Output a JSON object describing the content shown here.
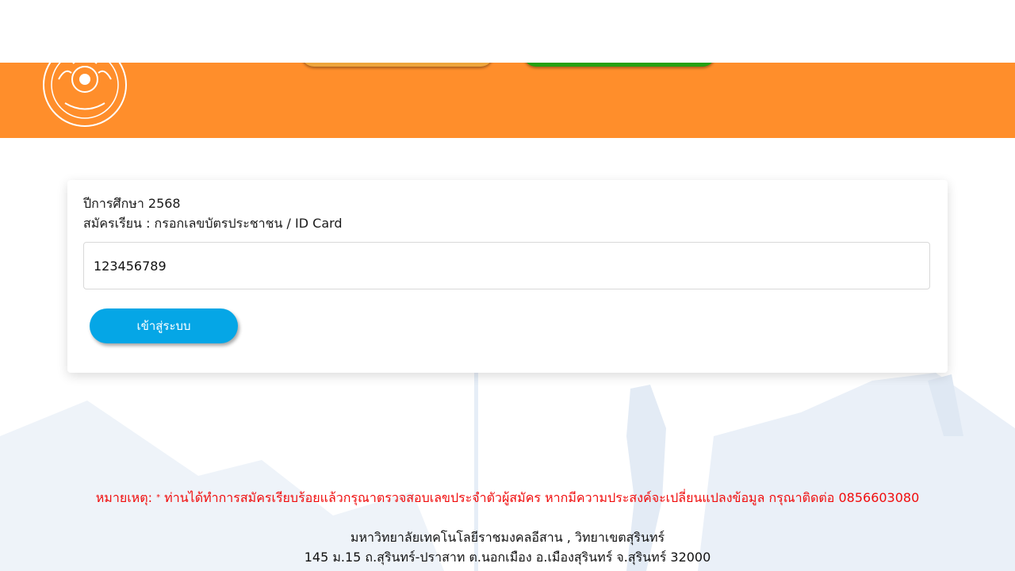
{
  "header": {
    "colors": {
      "band": "#ff8e2b",
      "yellow_tab": "#eea53c",
      "green_tab": "#25a012"
    },
    "logo_icon": "university-emblem-icon"
  },
  "login": {
    "academic_year": "ปีการศึกษา 2568",
    "instruction": "สมัครเรียน : กรอกเลขบัตรประชาชน / ID Card",
    "id_value": "123456789",
    "submit_label": "เข้าสู่ระบบ",
    "button_color": "#05a6e6"
  },
  "note": {
    "prefix": "หมายเหตุ:",
    "star": "*",
    "text": "ท่านได้ทำการสมัครเรียบร้อยแล้วกรุณาตรวจสอบเลขประจำตัวผู้สมัคร หากมีความประสงค์จะเปลี่ยนแปลงข้อมูล กรุณาติดต่อ 0856603080"
  },
  "footer": {
    "line1": "มหาวิทยาลัยเทคโนโลยีราชมงคลอีสาน , วิทยาเขตสุรินทร์",
    "line2": "145 ม.15 ถ.สุรินทร์-ปราสาท ต.นอกเมือง อ.เมืองสุรินทร์ จ.สุรินทร์ 32000"
  }
}
